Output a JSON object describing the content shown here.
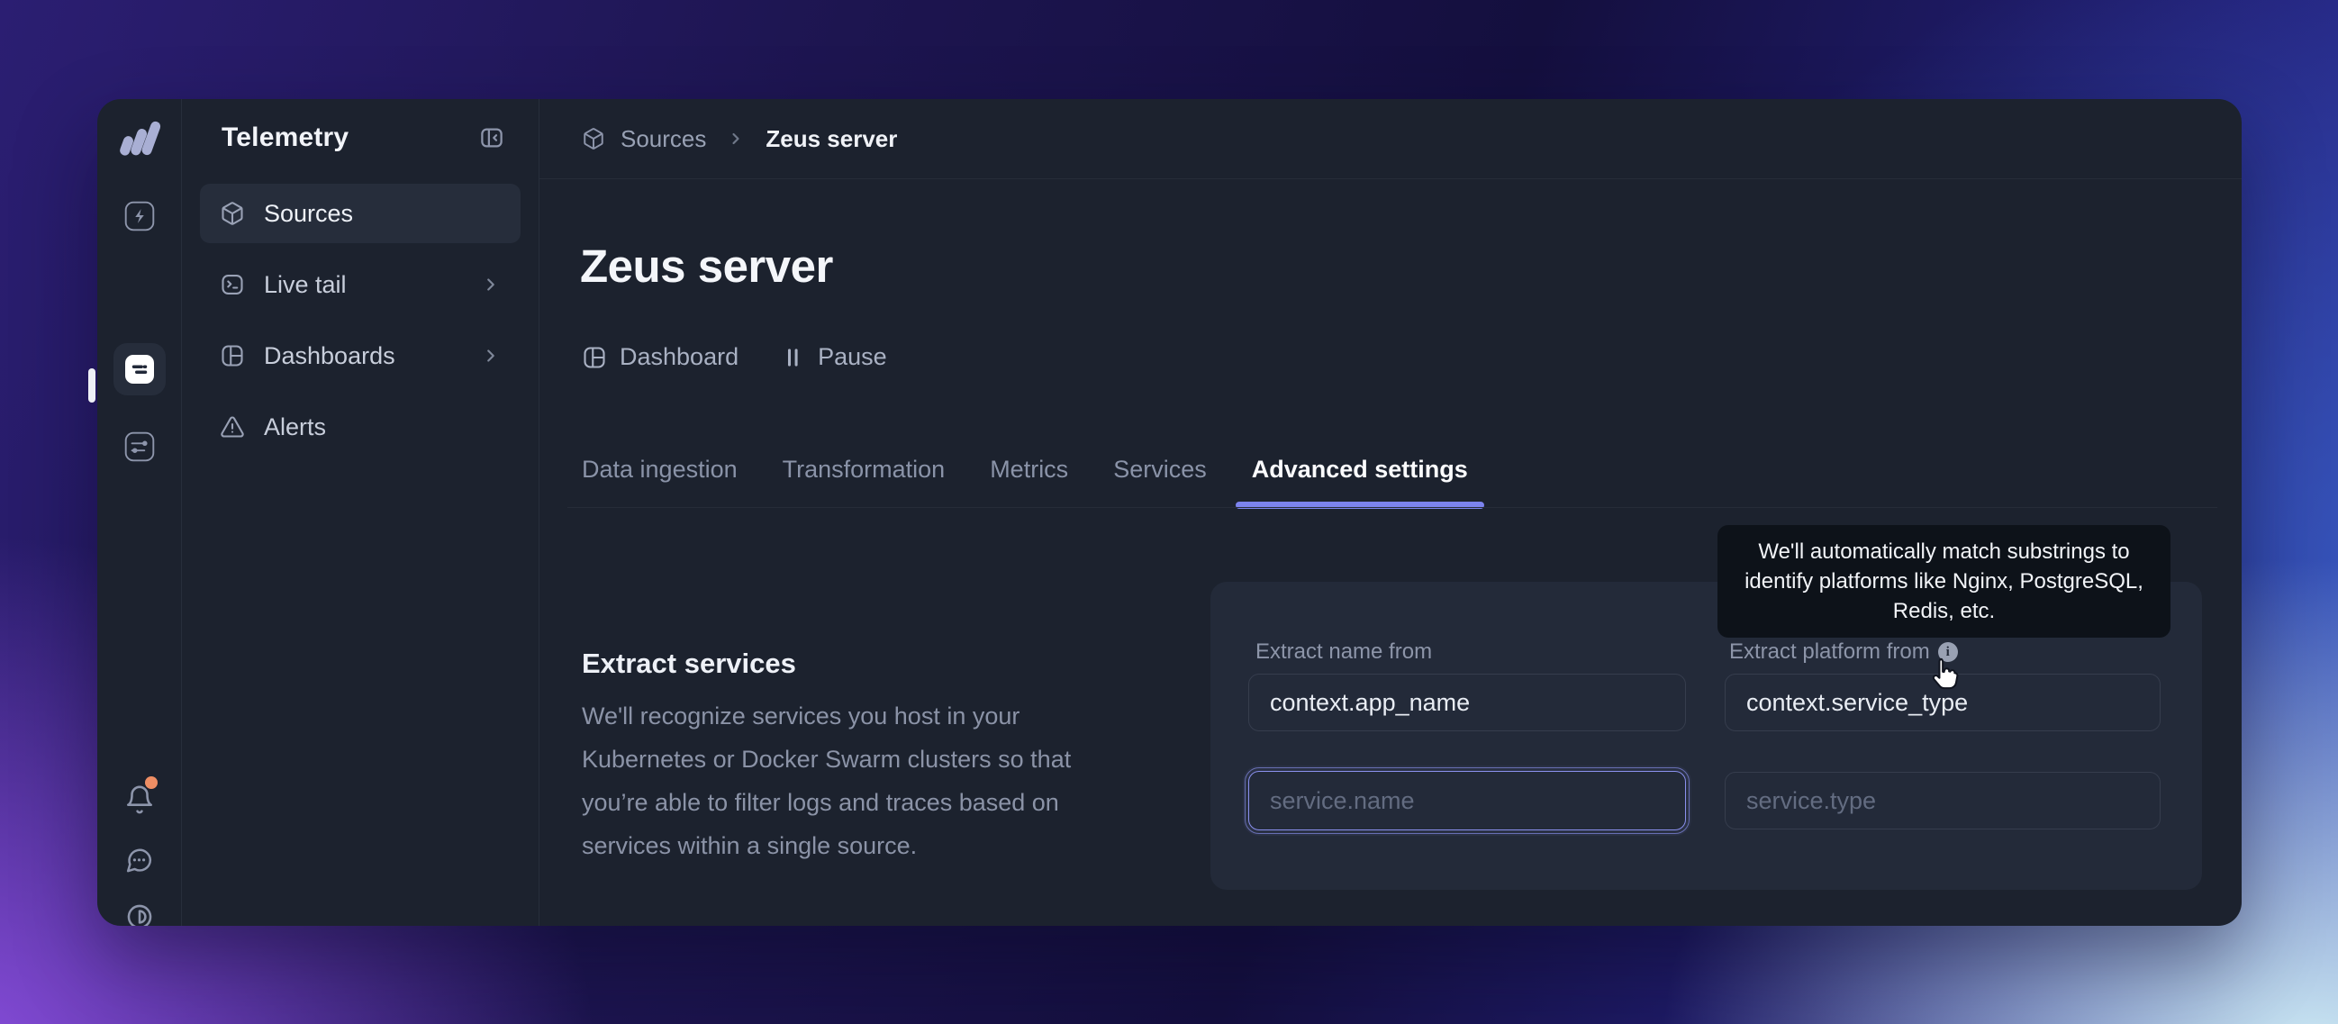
{
  "app": {
    "name": "Telemetry"
  },
  "rail": {
    "logo": "betterstack-logo",
    "items": [
      {
        "icon": "lightning-icon"
      },
      {
        "icon": "live-logs-icon",
        "active": true
      },
      {
        "icon": "sliders-icon"
      }
    ],
    "bottom": [
      {
        "icon": "bell-icon",
        "has_notification": true
      },
      {
        "icon": "chat-icon"
      },
      {
        "icon": "contrast-icon"
      }
    ]
  },
  "sidebar": {
    "title": "Telemetry",
    "items": [
      {
        "label": "Sources",
        "active": true
      },
      {
        "label": "Live tail",
        "has_submenu": true
      },
      {
        "label": "Dashboards",
        "has_submenu": true
      },
      {
        "label": "Alerts"
      }
    ]
  },
  "breadcrumb": {
    "root": "Sources",
    "current": "Zeus server"
  },
  "header": {
    "title": "Zeus server",
    "actions": {
      "dashboard": "Dashboard",
      "pause": "Pause"
    }
  },
  "tabs": {
    "items": [
      {
        "label": "Data ingestion"
      },
      {
        "label": "Transformation"
      },
      {
        "label": "Metrics"
      },
      {
        "label": "Services"
      },
      {
        "label": "Advanced settings"
      }
    ],
    "active": "Advanced settings"
  },
  "tooltip": {
    "text": "We'll automatically match substrings to identify platforms like Nginx, PostgreSQL, Redis, etc."
  },
  "section": {
    "title": "Extract services",
    "description": "We'll recognize services you host in your Kubernetes or Docker Swarm clusters so that you’re able to filter logs and traces based on services within a single source."
  },
  "form": {
    "name_field": {
      "label": "Extract name from",
      "value": "context.app_name",
      "placeholder": "service.name"
    },
    "platform_field": {
      "label": "Extract platform from",
      "value": "context.service_type",
      "placeholder": "service.type",
      "info_glyph": "i"
    }
  },
  "colors": {
    "accent": "#7c83ee",
    "notification_dot": "#ee8e64",
    "tooltip_bg": "#0d1219",
    "window_bg": "#1c222e",
    "card_bg": "#232a39"
  }
}
